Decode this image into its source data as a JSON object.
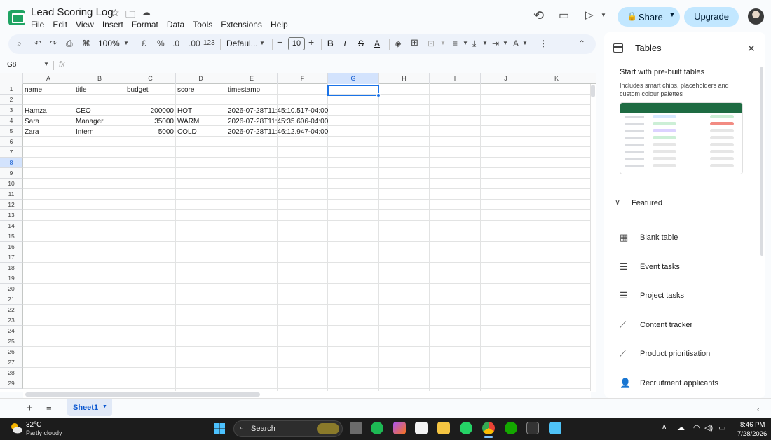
{
  "app": {
    "title": "Lead Scoring Log",
    "menu": [
      "File",
      "Edit",
      "View",
      "Insert",
      "Format",
      "Data",
      "Tools",
      "Extensions",
      "Help"
    ],
    "share_label": "Share",
    "upgrade_label": "Upgrade"
  },
  "toolbar": {
    "zoom": "100%",
    "currency": "£",
    "percent": "%",
    "dec_decrease": ".0",
    "dec_increase": ".00",
    "format_123": "123",
    "font": "Defaul...",
    "font_size": "10",
    "bold": "B",
    "italic": "I",
    "text_color_glyph": "A"
  },
  "formula_bar": {
    "name_box": "G8",
    "fx": "fx",
    "value": ""
  },
  "grid": {
    "columns": [
      "A",
      "B",
      "C",
      "D",
      "E",
      "F",
      "G",
      "H",
      "I",
      "J",
      "K"
    ],
    "selected_column": "G",
    "selected_row": 8,
    "rows": [
      "1",
      "2",
      "3",
      "4",
      "5",
      "6",
      "7",
      "8",
      "9",
      "10",
      "11",
      "12",
      "13",
      "14",
      "15",
      "16",
      "17",
      "18",
      "19",
      "20",
      "21",
      "22",
      "23",
      "24",
      "25",
      "26",
      "27",
      "28",
      "29"
    ],
    "headers": [
      "name",
      "title",
      "budget",
      "score",
      "timestamp"
    ],
    "data_rows": [
      {
        "name": "Hamza",
        "title": "CEO",
        "budget": "200000",
        "score": "HOT",
        "timestamp": "2026-07-28T11:45:10.517-04:00"
      },
      {
        "name": "Sara",
        "title": "Manager",
        "budget": "35000",
        "score": "WARM",
        "timestamp": "2026-07-28T11:45:35.606-04:00"
      },
      {
        "name": "Zara",
        "title": "Intern",
        "budget": "5000",
        "score": "COLD",
        "timestamp": "2026-07-28T11:46:12.947-04:00"
      }
    ]
  },
  "sheets": {
    "tabs": [
      "Sheet1"
    ]
  },
  "panel": {
    "title": "Tables",
    "prebuilt_title": "Start with pre-built tables",
    "prebuilt_desc": "Includes smart chips, placeholders and custom colour palettes",
    "featured_label": "Featured",
    "items": [
      {
        "label": "Blank table",
        "icon": "table-icon"
      },
      {
        "label": "Event tasks",
        "icon": "checklist-icon"
      },
      {
        "label": "Project tasks",
        "icon": "checklist-icon"
      },
      {
        "label": "Content tracker",
        "icon": "trend-icon"
      },
      {
        "label": "Product prioritisation",
        "icon": "trend-icon"
      },
      {
        "label": "Recruitment applicants",
        "icon": "person-icon"
      }
    ]
  },
  "taskbar": {
    "temperature": "32°C",
    "condition": "Partly cloudy",
    "search_label": "Search",
    "time": "8:46 PM",
    "date": "7/28/2026"
  },
  "colors": {
    "accent": "#1a73e8",
    "share_bg": "#c2e7ff",
    "sheets_green": "#1fa463"
  }
}
